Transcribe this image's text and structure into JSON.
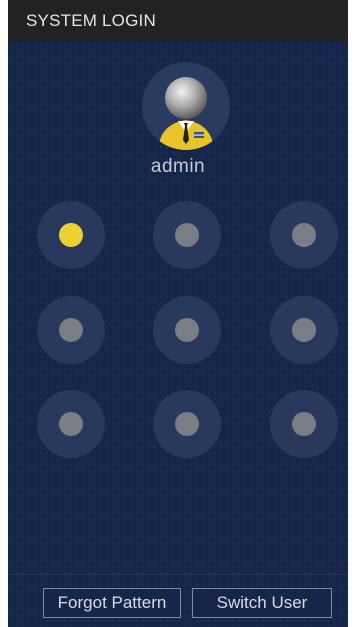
{
  "window": {
    "title": "SYSTEM LOGIN"
  },
  "user": {
    "name": "admin",
    "avatar_icon": "user-avatar-icon"
  },
  "pattern": {
    "rows": 3,
    "cols": 3,
    "selected_nodes": [
      1
    ],
    "active_color": "#ecd230",
    "inactive_color": "#7a7d86"
  },
  "footer": {
    "forgot_label": "Forgot Pattern",
    "switch_label": "Switch User"
  }
}
